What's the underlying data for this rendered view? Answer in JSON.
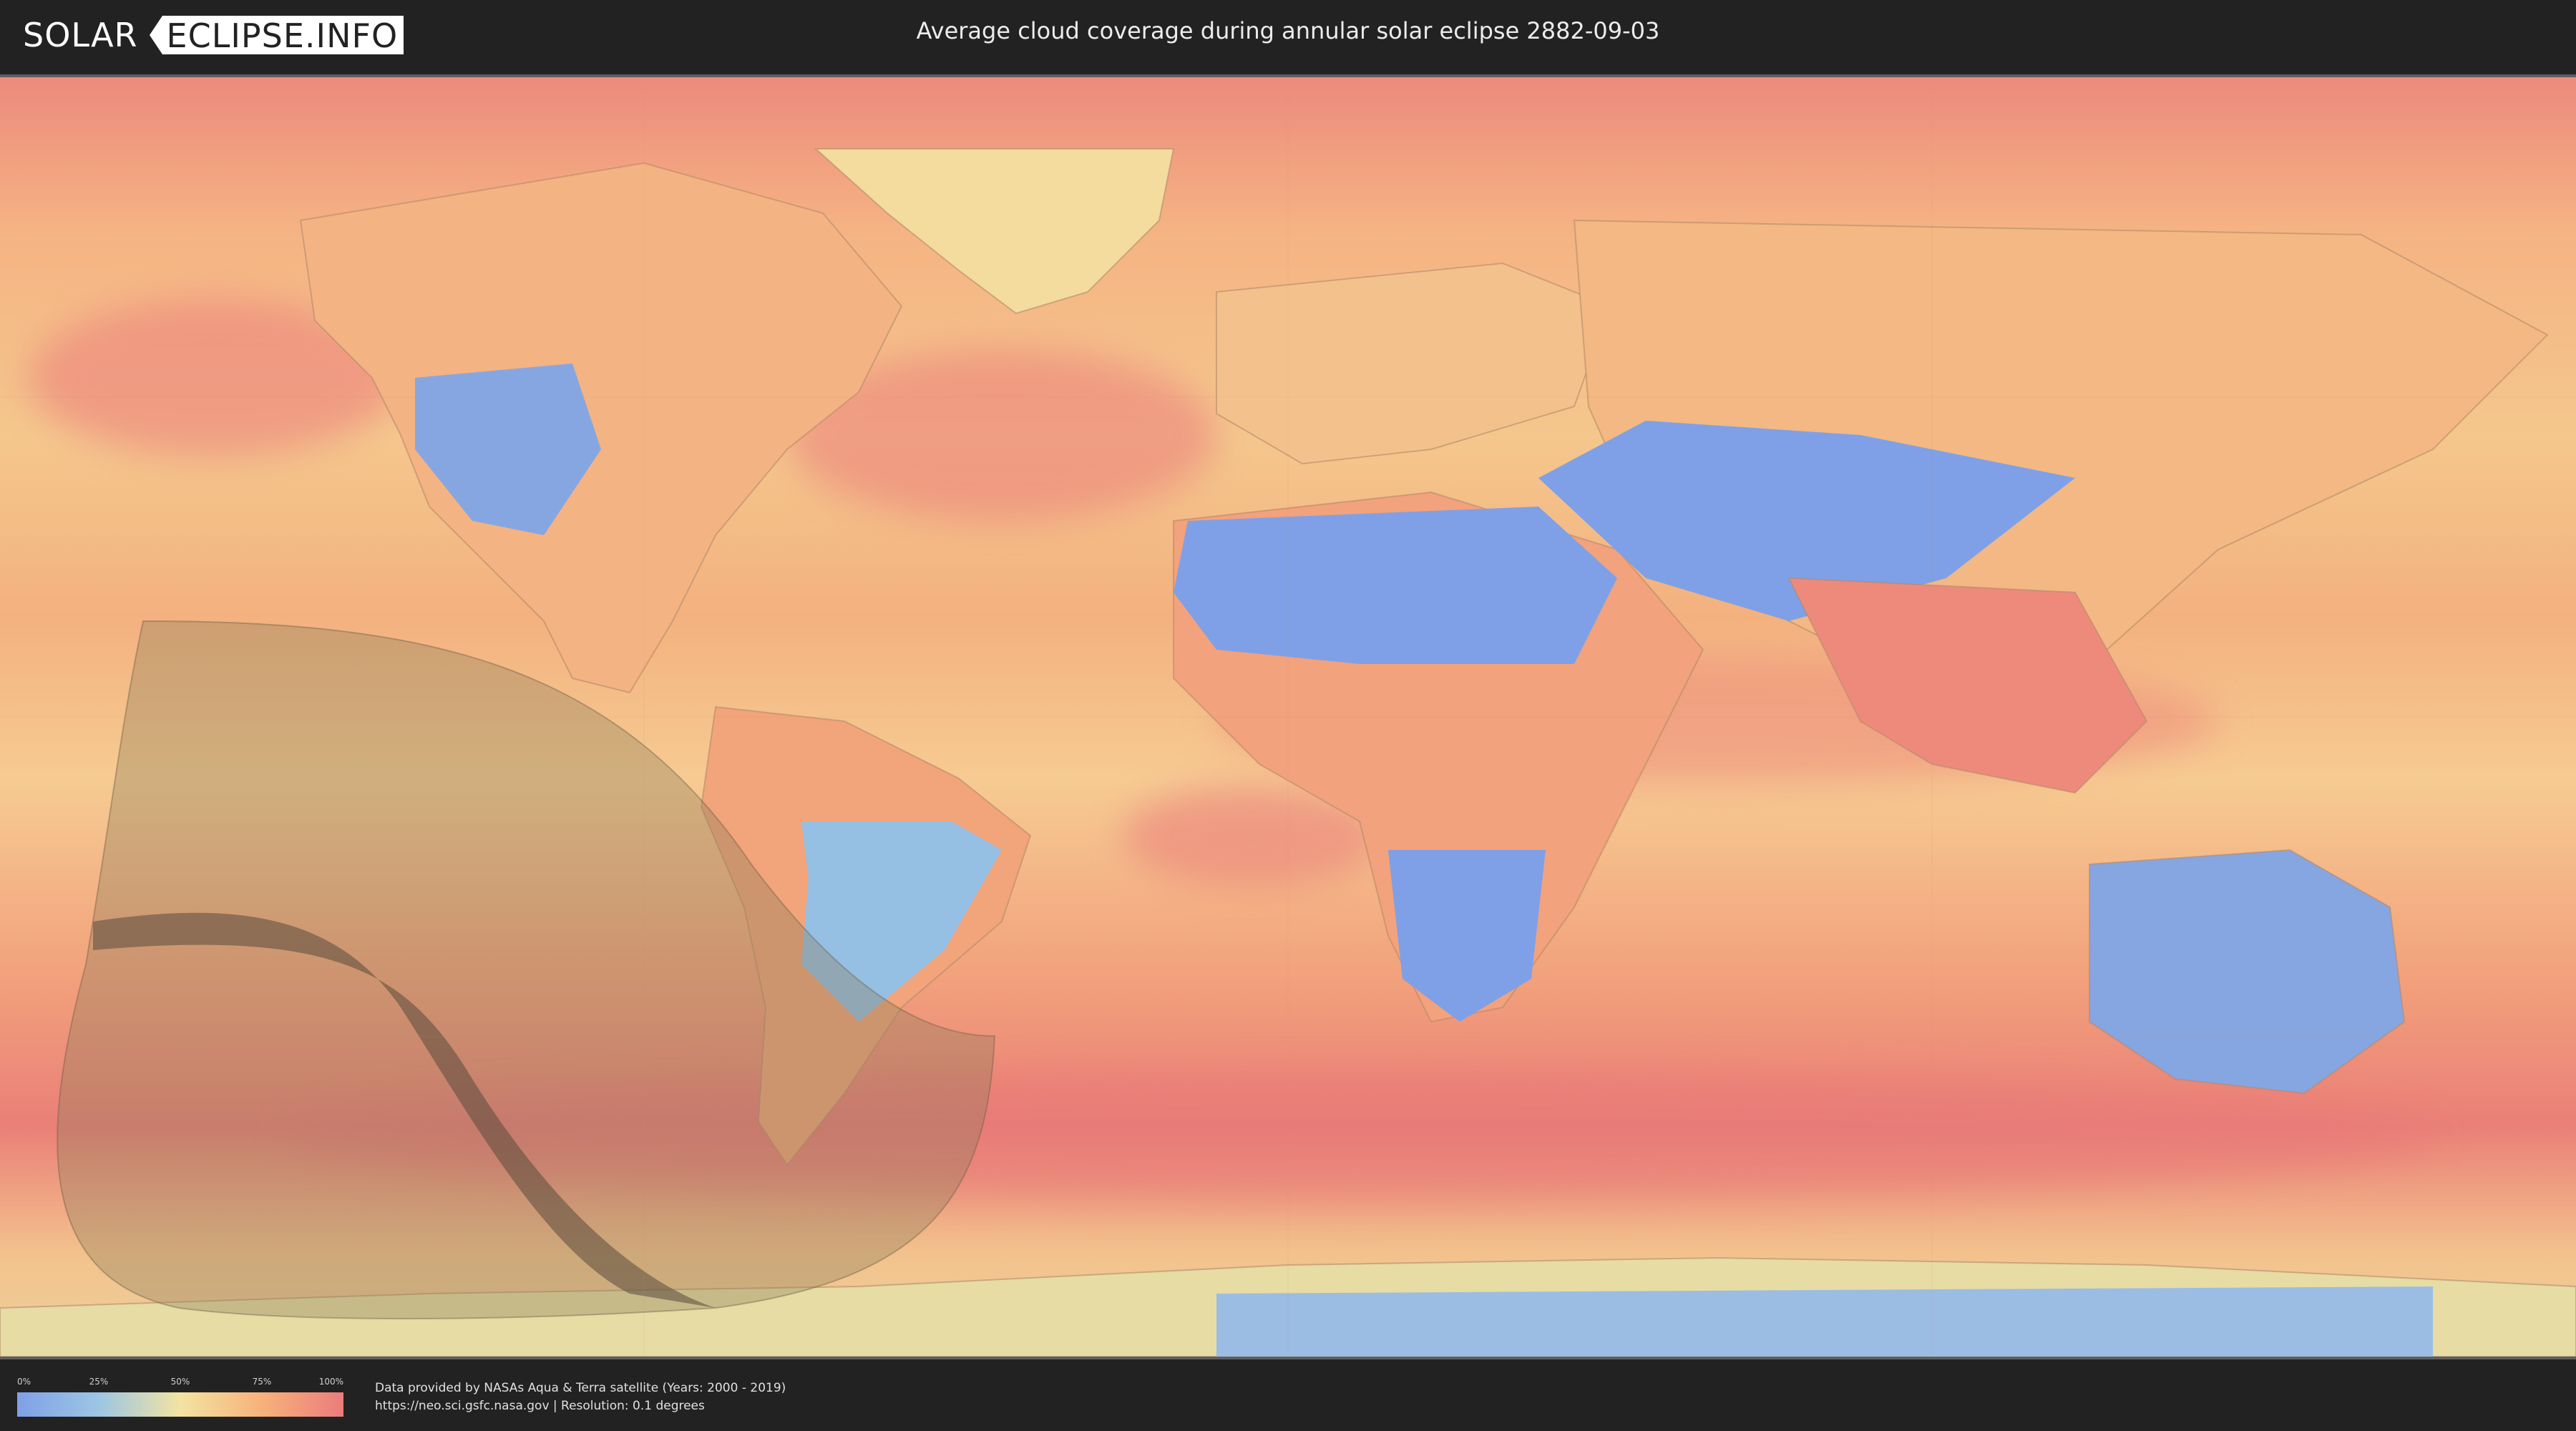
{
  "header": {
    "logo_left": "SOLAR",
    "logo_right": "ECLIPSE.INFO",
    "title": "Average cloud coverage during annular solar eclipse 2882-09-03"
  },
  "legend": {
    "ticks": [
      "0%",
      "25%",
      "50%",
      "75%",
      "100%"
    ],
    "colors": [
      "#7fa0e6",
      "#9cc6e4",
      "#f3e3a2",
      "#f6b27a",
      "#ec7c7c"
    ]
  },
  "credits": {
    "line1": "Data provided by NASAs Aqua & Terra satellite (Years: 2000 - 2019)",
    "line2": "https://neo.sci.gsfc.nasa.gov | Resolution: 0.1 degrees"
  },
  "map": {
    "ocean_color": "#f2a77e",
    "clear_sky_color": "#7fa0e6",
    "cloudy_color": "#ec7c7c",
    "penumbra_color": "#8a7a5a",
    "central_path_color": "#5a4a3c"
  }
}
